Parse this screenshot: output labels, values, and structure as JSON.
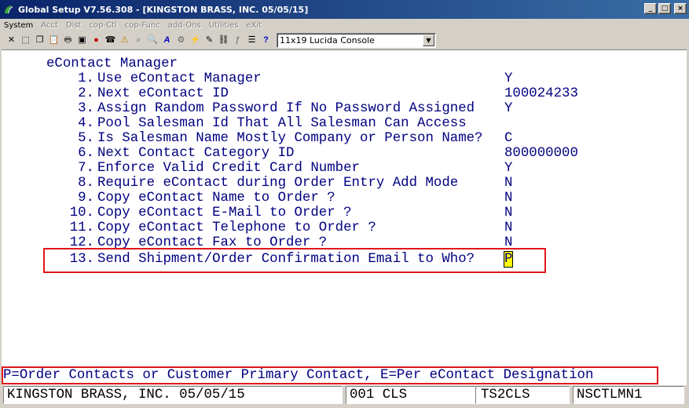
{
  "window": {
    "title": "Global Setup V7.56.308 - [KINGSTON BRASS, INC. 05/05/15]",
    "minimize": "_",
    "restore": "□",
    "close": "×",
    "titlebar_color": "#0a246a"
  },
  "menu": [
    {
      "label": "System",
      "enabled": true
    },
    {
      "label": "Acct",
      "enabled": false
    },
    {
      "label": "Dist",
      "enabled": false
    },
    {
      "label": "cop-Ctl",
      "enabled": false
    },
    {
      "label": "cop-Func",
      "enabled": false
    },
    {
      "label": "add-Ons",
      "enabled": false
    },
    {
      "label": "Utilities",
      "enabled": false
    },
    {
      "label": "eXit",
      "enabled": false
    }
  ],
  "toolbar": {
    "buttons": [
      {
        "icon": "close-x-icon",
        "glyph": "✕"
      },
      {
        "icon": "select-icon",
        "glyph": "⬚"
      },
      {
        "icon": "copy-icon",
        "glyph": "❐"
      },
      {
        "icon": "paste-icon",
        "glyph": "📋"
      },
      {
        "icon": "print-icon",
        "glyph": "🖶"
      },
      {
        "icon": "cop-ctl-icon",
        "glyph": "▣"
      },
      {
        "icon": "stop-icon",
        "glyph": "●"
      },
      {
        "icon": "help-desk-icon",
        "glyph": "☎"
      },
      {
        "icon": "warning-icon",
        "glyph": "⚠"
      },
      {
        "icon": "zoom-icon",
        "glyph": "⌕"
      },
      {
        "icon": "find-icon",
        "glyph": "🔍"
      },
      {
        "icon": "font-icon",
        "glyph": "A"
      },
      {
        "icon": "tools-icon",
        "glyph": "⚙"
      },
      {
        "icon": "lightning-icon",
        "glyph": "⚡"
      },
      {
        "icon": "scripts-icon",
        "glyph": "✎"
      },
      {
        "icon": "link-icon",
        "glyph": "⛓"
      },
      {
        "icon": "function-icon",
        "glyph": "ƒ"
      },
      {
        "icon": "list-icon",
        "glyph": "☰"
      },
      {
        "icon": "context-help-icon",
        "glyph": "?"
      }
    ],
    "font_select": {
      "value": "11x19 Lucida Console",
      "arrow": "▼"
    }
  },
  "screen": {
    "heading": "eContact Manager",
    "text_color": "#000080",
    "items": [
      {
        "num": "1.",
        "label": "Use eContact Manager",
        "value": "Y"
      },
      {
        "num": "2.",
        "label": "Next eContact ID",
        "value": "100024233"
      },
      {
        "num": "3.",
        "label": "Assign Random Password If No Password Assigned",
        "value": "Y"
      },
      {
        "num": "4.",
        "label": "Pool Salesman Id That All Salesman Can Access",
        "value": ""
      },
      {
        "num": "5.",
        "label": "Is Salesman Name Mostly Company or Person Name?",
        "value": "C"
      },
      {
        "num": "6.",
        "label": "Next Contact Category ID",
        "value": "800000000"
      },
      {
        "num": "7.",
        "label": "Enforce Valid Credit Card Number",
        "value": "Y"
      },
      {
        "num": "8.",
        "label": "Require eContact during Order Entry Add Mode",
        "value": "N"
      },
      {
        "num": "9.",
        "label": "Copy eContact Name to Order ?",
        "value": "N"
      },
      {
        "num": "10.",
        "label": "Copy eContact E-Mail to Order ?",
        "value": "N"
      },
      {
        "num": "11.",
        "label": "Copy eContact Telephone to Order ?",
        "value": "N"
      },
      {
        "num": "12.",
        "label": "Copy eContact Fax to Order ?",
        "value": "N"
      },
      {
        "num": "13.",
        "label": "Send Shipment/Order Confirmation Email to Who?",
        "value": "P"
      }
    ],
    "help_line": "P=Order Contacts or Customer Primary Contact, E=Per eContact Designation",
    "highlight_color": "#e0161b",
    "cursor_color": "#ffff00"
  },
  "status_bar": {
    "company": "KINGSTON BRASS, INC. 05/05/15",
    "session": "001 CLS",
    "terminal": "TS2CLS",
    "program": "NSCTLMN1"
  }
}
